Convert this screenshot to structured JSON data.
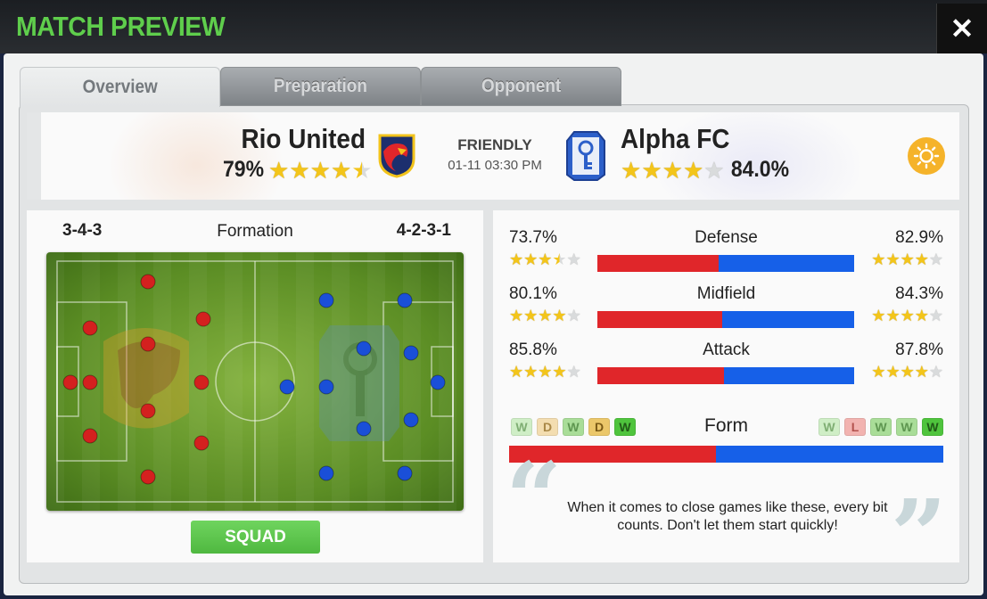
{
  "window": {
    "title": "MATCH PREVIEW",
    "close_label": "✕"
  },
  "tabs": [
    {
      "label": "Overview",
      "active": true
    },
    {
      "label": "Preparation",
      "active": false
    },
    {
      "label": "Opponent",
      "active": false
    }
  ],
  "match": {
    "type": "FRIENDLY",
    "datetime": "01-11 03:30 PM",
    "weather_icon": "sun-icon",
    "home": {
      "name": "Rio United",
      "rating": "79%",
      "stars": 4.5,
      "crest_icon": "red-dragon-crest-icon"
    },
    "away": {
      "name": "Alpha FC",
      "rating": "84.0%",
      "stars": 4,
      "crest_icon": "blue-key-crest-icon"
    }
  },
  "formation": {
    "label": "Formation",
    "home": "3-4-3",
    "away": "4-2-3-1",
    "squad_button": "SQUAD",
    "colors": {
      "home": "#d4201f",
      "away": "#1a4fd8"
    }
  },
  "stats": [
    {
      "name": "Defense",
      "home": "73.7%",
      "away": "82.9%",
      "home_stars": 3.5,
      "away_stars": 4,
      "home_value": 73.7,
      "away_value": 82.9
    },
    {
      "name": "Midfield",
      "home": "80.1%",
      "away": "84.3%",
      "home_stars": 4,
      "away_stars": 4,
      "home_value": 80.1,
      "away_value": 84.3
    },
    {
      "name": "Attack",
      "home": "85.8%",
      "away": "87.8%",
      "home_stars": 4,
      "away_stars": 4,
      "home_value": 85.8,
      "away_value": 87.8
    }
  ],
  "form": {
    "label": "Form",
    "home": [
      "W",
      "D",
      "W",
      "D",
      "W"
    ],
    "away": [
      "W",
      "L",
      "W",
      "W",
      "W"
    ],
    "home_share": 0.477
  },
  "quote": {
    "text": "When it comes to close games like these, every bit counts. Don't let them start quickly!"
  }
}
